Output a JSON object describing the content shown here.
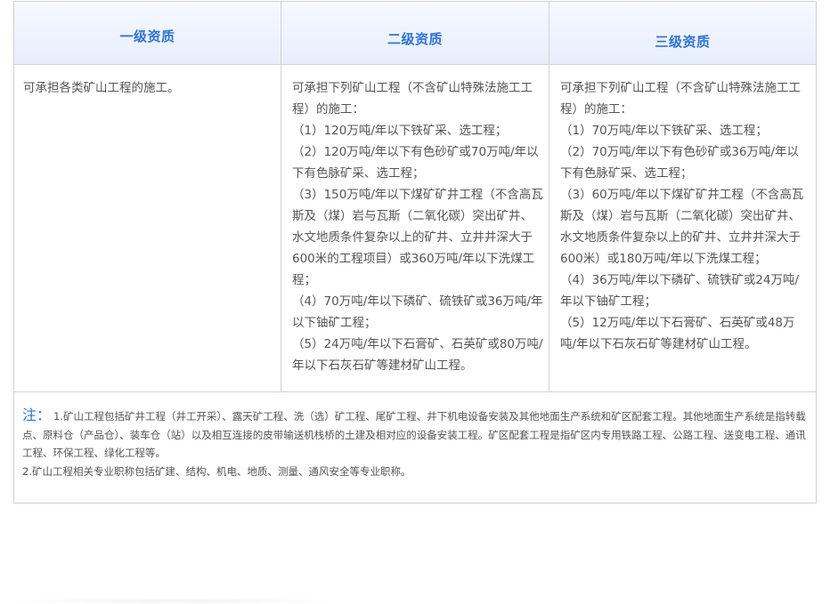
{
  "table": {
    "headers": [
      "一级资质",
      "二级资质",
      "三级资质"
    ],
    "level1": {
      "lines": [
        "可承担各类矿山工程的施工。"
      ]
    },
    "level2": {
      "lines": [
        "可承担下列矿山工程（不含矿山特殊法施工工程）的施工：",
        "（1）120万吨/年以下铁矿采、选工程；",
        "（2）120万吨/年以下有色砂矿或70万吨/年以下有色脉矿采、选工程；",
        "（3）150万吨/年以下煤矿矿井工程（不含高瓦斯及（煤）岩与瓦斯（二氧化碳）突出矿井、水文地质条件复杂以上的矿井、立井井深大于600米的工程项目）或360万吨/年以下洗煤工程；",
        "（4）70万吨/年以下磷矿、硫铁矿或36万吨/年以下铀矿工程；",
        "（5）24万吨/年以下石膏矿、石英矿或80万吨/年以下石灰石矿等建材矿山工程。"
      ]
    },
    "level3": {
      "lines": [
        "可承担下列矿山工程（不含矿山特殊法施工工程）的施工：",
        "（1）70万吨/年以下铁矿采、选工程；",
        "（2）70万吨/年以下有色砂矿或36万吨/年以下有色脉矿采、选工程；",
        "（3）60万吨/年以下煤矿矿井工程（不含高瓦斯及（煤）岩与瓦斯（二氧化碳）突出矿井、水文地质条件复杂以上的矿井、立井井深大于600米）或180万吨/年以下洗煤工程；",
        "（4）36万吨/年以下磷矿、硫铁矿或24万吨/年以下铀矿工程；",
        "（5）12万吨/年以下石膏矿、石英矿或48万吨/年以下石灰石矿等建材矿山工程。"
      ]
    }
  },
  "note": {
    "label": "注：",
    "item1": "1.矿山工程包括矿井工程（井工开采）、露天矿工程、洗（选）矿工程、尾矿工程、井下机电设备安装及其他地面生产系统和矿区配套工程。其他地面生产系统是指转载点、原料仓（产品仓）、装车仓（站）以及相互连接的皮带输送机栈桥的土建及相对应的设备安装工程。矿区配套工程是指矿区内专用铁路工程、公路工程、送变电工程、通讯工程、环保工程、绿化工程等。",
    "item2": "2.矿山工程相关专业职称包括矿建、结构、机电、地质、测量、通风安全等专业职称。"
  },
  "colors": {
    "accent": "#2f73d4",
    "header_bg": "#e7eefc",
    "border": "#d3d3d3",
    "text": "#555555"
  }
}
